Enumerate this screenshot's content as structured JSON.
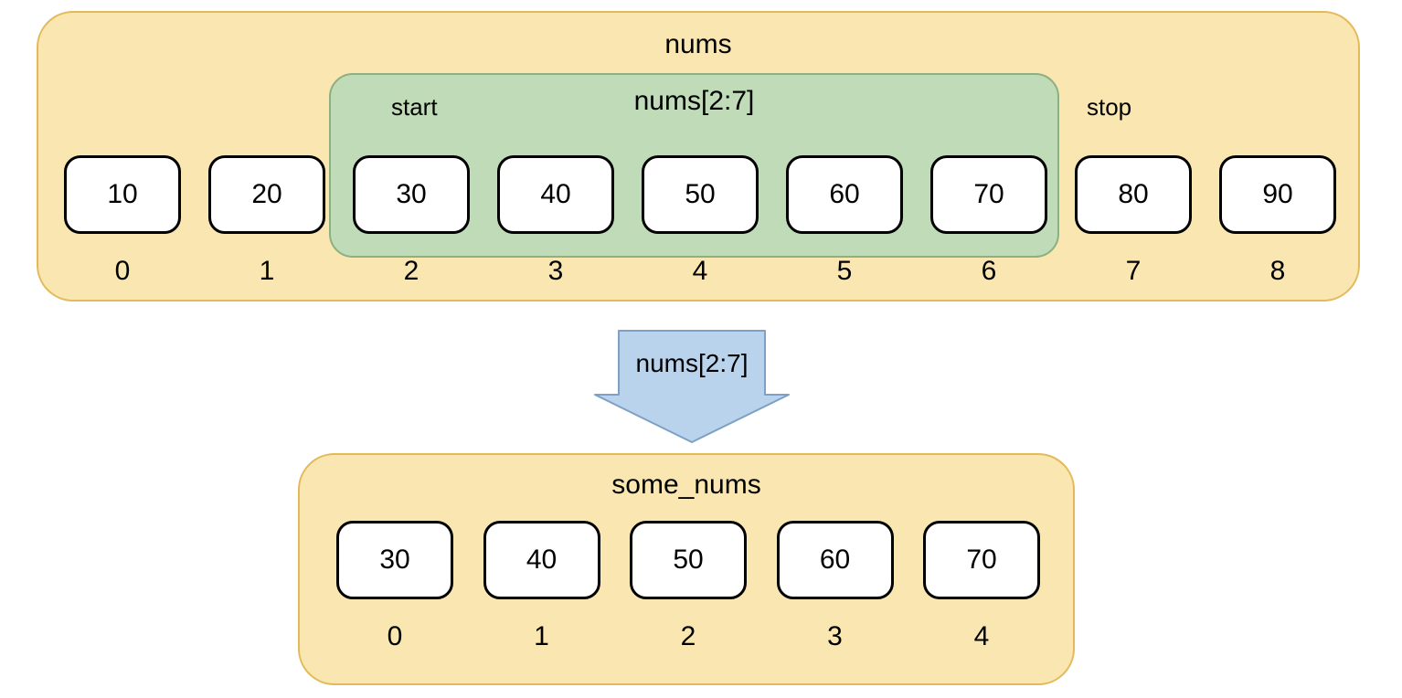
{
  "top": {
    "title": "nums",
    "slice_label": "nums[2:7]",
    "start_label": "start",
    "stop_label": "stop",
    "values": [
      "10",
      "20",
      "30",
      "40",
      "50",
      "60",
      "70",
      "80",
      "90"
    ],
    "indices": [
      "0",
      "1",
      "2",
      "3",
      "4",
      "5",
      "6",
      "7",
      "8"
    ],
    "slice_start_index": 2,
    "slice_stop_index": 7
  },
  "arrow": {
    "label": "nums[2:7]"
  },
  "bottom": {
    "title": "some_nums",
    "values": [
      "30",
      "40",
      "50",
      "60",
      "70"
    ],
    "indices": [
      "0",
      "1",
      "2",
      "3",
      "4"
    ]
  },
  "colors": {
    "container_fill": "#fae6b1",
    "container_border": "#e3ba5a",
    "slice_fill": "#bfdbb8",
    "slice_border": "#8cb07f",
    "arrow_fill": "#b9d3ed",
    "arrow_border": "#7ea0c4"
  }
}
